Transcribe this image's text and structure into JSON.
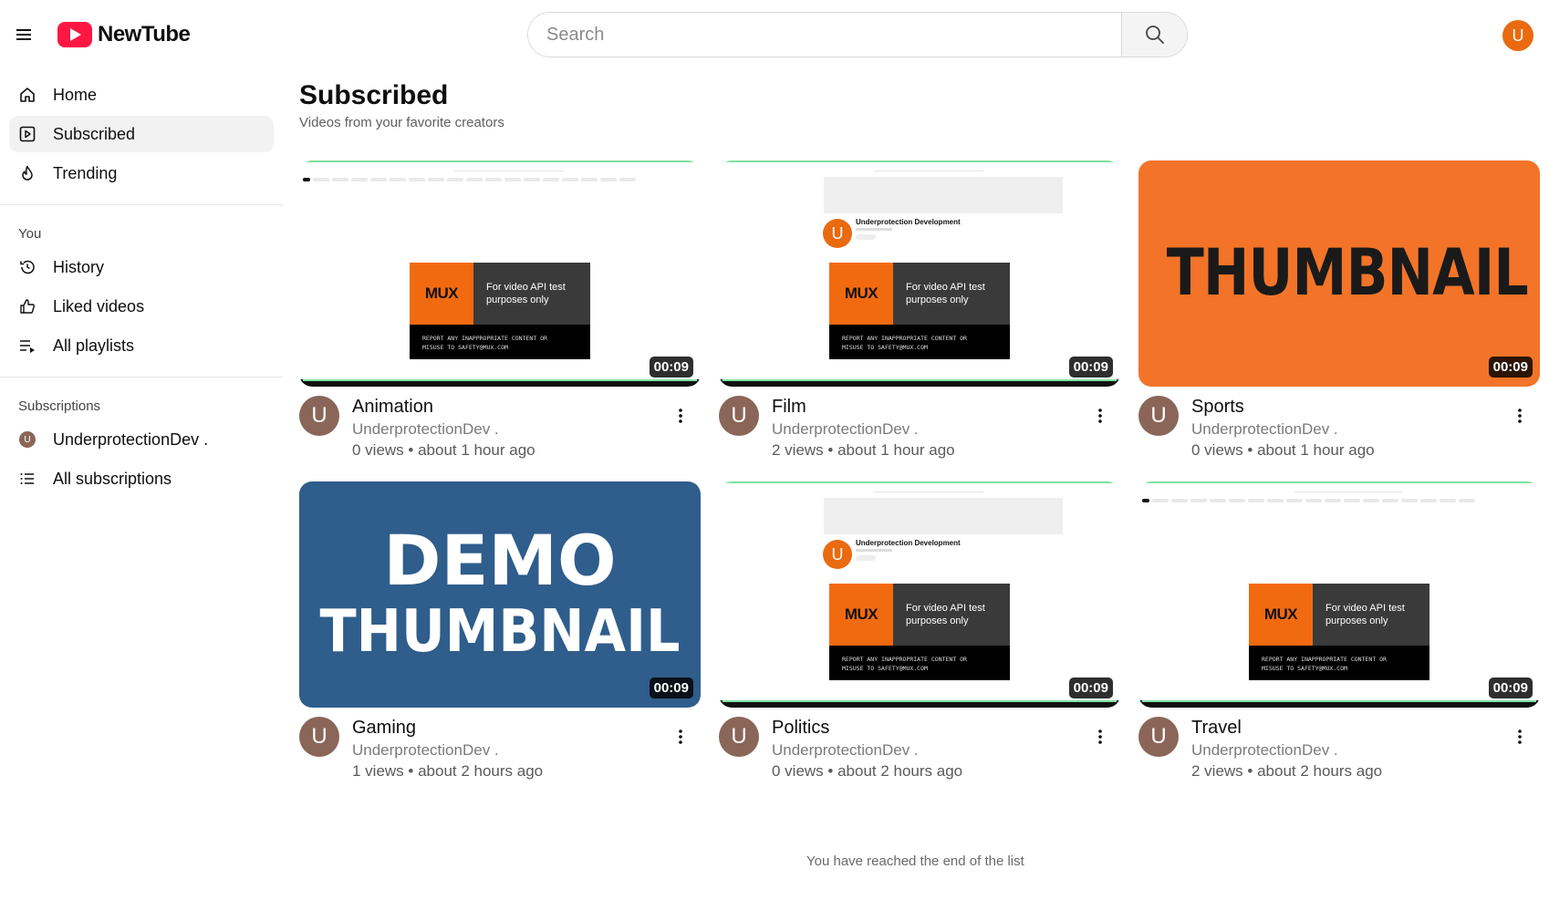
{
  "app": {
    "logo_text": "NewTube",
    "brand_color": "#ff1744",
    "accent_avatar_color": "#ea6a10"
  },
  "header": {
    "search_placeholder": "Search",
    "user_avatar_letter": "U"
  },
  "sidebar": {
    "main_items": [
      {
        "label": "Home",
        "icon": "home-icon",
        "active": false
      },
      {
        "label": "Subscribed",
        "icon": "subscriptions-icon",
        "active": true
      },
      {
        "label": "Trending",
        "icon": "flame-icon",
        "active": false
      }
    ],
    "you_title": "You",
    "you_items": [
      {
        "label": "History",
        "icon": "history-icon"
      },
      {
        "label": "Liked videos",
        "icon": "thumbs-up-icon"
      },
      {
        "label": "All playlists",
        "icon": "playlist-icon"
      }
    ],
    "subscriptions_title": "Subscriptions",
    "subscription_items": [
      {
        "label": "UnderprotectionDev .",
        "avatar_letter": "U"
      },
      {
        "label": "All subscriptions",
        "icon": "list-icon"
      }
    ]
  },
  "main": {
    "title": "Subscribed",
    "subtitle": "Videos from your favorite creators",
    "end_message": "You have reached the end of the list"
  },
  "thumbnail_text": {
    "mux_logo": "MUX",
    "mux_line1": "For video API test",
    "mux_line2": "purposes only",
    "mux_warn1": "REPORT ANY INAPPROPRIATE CONTENT OR",
    "mux_warn2": "MISUSE TO SAFETY@MUX.COM",
    "channel_name": "Underprotection Development",
    "orange_text": "THUMBNAIL",
    "blue_line1": "DEMO",
    "blue_line2": "THUMBNAIL"
  },
  "videos": [
    {
      "title": "Animation",
      "channel": "UnderprotectionDev .",
      "stats": "0 views • about 1 hour ago",
      "duration": "00:09",
      "avatar_letter": "U",
      "thumbnail": "home-screenshot"
    },
    {
      "title": "Film",
      "channel": "UnderprotectionDev .",
      "stats": "2 views • about 1 hour ago",
      "duration": "00:09",
      "avatar_letter": "U",
      "thumbnail": "channel-screenshot"
    },
    {
      "title": "Sports",
      "channel": "UnderprotectionDev .",
      "stats": "0 views • about 1 hour ago",
      "duration": "00:09",
      "avatar_letter": "U",
      "thumbnail": "orange-thumbnail"
    },
    {
      "title": "Gaming",
      "channel": "UnderprotectionDev .",
      "stats": "1 views • about 2 hours ago",
      "duration": "00:09",
      "avatar_letter": "U",
      "thumbnail": "demo-thumbnail"
    },
    {
      "title": "Politics",
      "channel": "UnderprotectionDev .",
      "stats": "0 views • about 2 hours ago",
      "duration": "00:09",
      "avatar_letter": "U",
      "thumbnail": "channel-screenshot"
    },
    {
      "title": "Travel",
      "channel": "UnderprotectionDev .",
      "stats": "2 views • about 2 hours ago",
      "duration": "00:09",
      "avatar_letter": "U",
      "thumbnail": "home-screenshot"
    }
  ]
}
